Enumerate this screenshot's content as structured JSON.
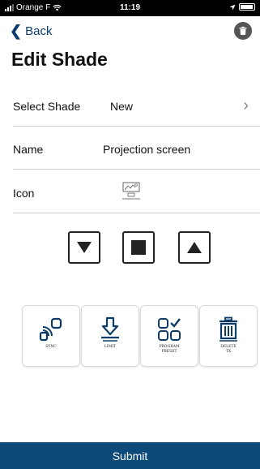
{
  "status_bar": {
    "carrier": "Orange F",
    "time": "11:19"
  },
  "nav": {
    "back_label": "Back"
  },
  "page": {
    "title": "Edit Shade"
  },
  "form": {
    "select_shade": {
      "label": "Select Shade",
      "value": "New"
    },
    "name": {
      "label": "Name",
      "value": "Projection screen"
    },
    "icon": {
      "label": "Icon",
      "value": "projection-screen-icon"
    }
  },
  "controls": [
    "down",
    "stop",
    "up"
  ],
  "actions": {
    "sync": "SYNC",
    "limit": "LIMIT",
    "program_preset_1": "PROGRAM",
    "program_preset_2": "PRESET",
    "delete_tx_1": "DELETE",
    "delete_tx_2": "TX"
  },
  "submit_label": "Submit",
  "colors": {
    "accent": "#0d4a7a",
    "back": "#0c3a6e"
  }
}
